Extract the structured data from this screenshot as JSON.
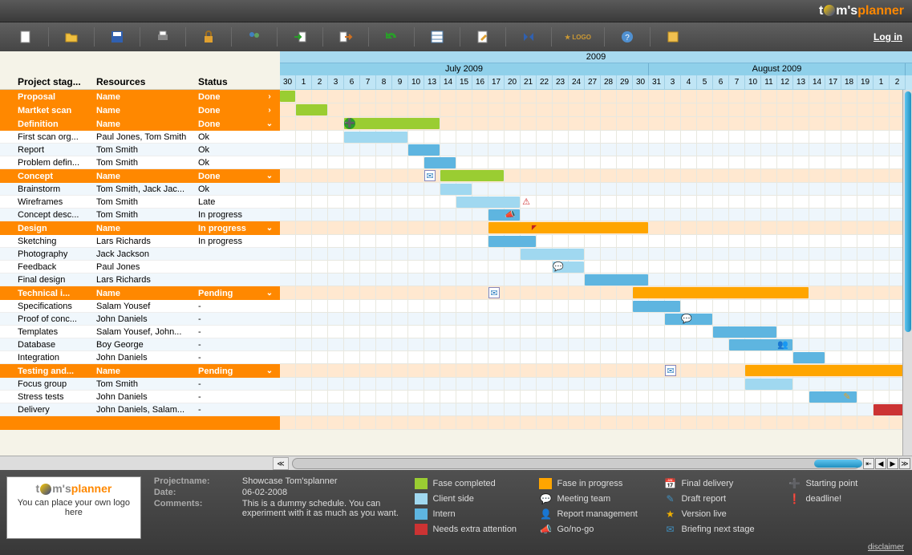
{
  "brand": {
    "t1": "t",
    "t2": "m's",
    "t3": "planner"
  },
  "login": "Log in",
  "columns": {
    "c1": "Project stag...",
    "c2": "Resources",
    "c3": "Status"
  },
  "timeline": {
    "year": "2009",
    "months": [
      {
        "label": "July 2009",
        "span": 23
      },
      {
        "label": "August 2009",
        "span": 16
      }
    ],
    "days": [
      "30",
      "1",
      "2",
      "3",
      "6",
      "7",
      "8",
      "9",
      "10",
      "13",
      "14",
      "15",
      "16",
      "17",
      "20",
      "21",
      "22",
      "23",
      "24",
      "27",
      "28",
      "29",
      "30",
      "31",
      "3",
      "4",
      "5",
      "6",
      "7",
      "10",
      "11",
      "12",
      "13",
      "14",
      "17",
      "18",
      "19",
      "1",
      "2"
    ]
  },
  "cellw": 20,
  "rows": [
    {
      "type": "phase",
      "c1": "Proposal",
      "c2": "Name",
      "c3": "Done",
      "caret": "›",
      "bars": [
        {
          "s": 0,
          "e": 1,
          "c": "green"
        }
      ]
    },
    {
      "type": "phase",
      "c1": "Martket scan",
      "c2": "Name",
      "c3": "Done",
      "caret": "›",
      "bars": [
        {
          "s": 1,
          "e": 3,
          "c": "green"
        }
      ]
    },
    {
      "type": "phase",
      "c1": "Definition",
      "c2": "Name",
      "c3": "Done",
      "caret": "⌄",
      "bars": [
        {
          "s": 4,
          "e": 10,
          "c": "green"
        }
      ],
      "icons": [
        {
          "p": 4,
          "t": "➕",
          "bg": "#2a9d2a",
          "col": "#fff",
          "r": "50%"
        }
      ]
    },
    {
      "type": "task",
      "c1": "First scan org...",
      "c2": "Paul Jones, Tom Smith",
      "c3": "Ok",
      "bars": [
        {
          "s": 4,
          "e": 8,
          "c": "lblue"
        }
      ]
    },
    {
      "type": "task",
      "alt": 1,
      "c1": "Report",
      "c2": "Tom Smith",
      "c3": "Ok",
      "bars": [
        {
          "s": 8,
          "e": 10,
          "c": "blue"
        }
      ]
    },
    {
      "type": "task",
      "c1": "Problem defin...",
      "c2": "Tom Smith",
      "c3": "Ok",
      "bars": [
        {
          "s": 9,
          "e": 11,
          "c": "blue"
        }
      ]
    },
    {
      "type": "phase",
      "c1": "Concept",
      "c2": "Name",
      "c3": "Done",
      "caret": "⌄",
      "bars": [
        {
          "s": 10,
          "e": 14,
          "c": "green"
        }
      ],
      "icons": [
        {
          "p": 9,
          "t": "✉",
          "bg": "#fff",
          "col": "#3080c0",
          "b": "1px solid #88b"
        }
      ]
    },
    {
      "type": "task",
      "alt": 1,
      "c1": "Brainstorm",
      "c2": "Tom Smith, Jack Jac...",
      "c3": "Ok",
      "bars": [
        {
          "s": 10,
          "e": 12,
          "c": "lblue"
        }
      ]
    },
    {
      "type": "task",
      "c1": "Wireframes",
      "c2": "Tom Smith",
      "c3": "Late",
      "bars": [
        {
          "s": 11,
          "e": 15,
          "c": "lblue"
        }
      ],
      "icons": [
        {
          "p": 15,
          "t": "⚠",
          "col": "#d03030"
        }
      ]
    },
    {
      "type": "task",
      "alt": 1,
      "c1": "Concept desc...",
      "c2": "Tom Smith",
      "c3": "In progress",
      "bars": [
        {
          "s": 13,
          "e": 15,
          "c": "blue"
        }
      ],
      "icons": [
        {
          "p": 14,
          "t": "📣",
          "col": "#e8a020"
        }
      ]
    },
    {
      "type": "phase",
      "c1": "Design",
      "c2": "Name",
      "c3": "In progress",
      "caret": "⌄",
      "bars": [
        {
          "s": 13,
          "e": 23,
          "c": "orange"
        }
      ],
      "icons": [
        {
          "p": 15.5,
          "t": "◤",
          "col": "#c02020",
          "fs": "8px"
        }
      ]
    },
    {
      "type": "task",
      "c1": "Sketching",
      "c2": "Lars Richards",
      "c3": "In progress",
      "bars": [
        {
          "s": 13,
          "e": 16,
          "c": "blue"
        }
      ]
    },
    {
      "type": "task",
      "alt": 1,
      "c1": "Photography",
      "c2": "Jack Jackson",
      "c3": "",
      "bars": [
        {
          "s": 15,
          "e": 19,
          "c": "lblue"
        }
      ]
    },
    {
      "type": "task",
      "c1": "Feedback",
      "c2": "Paul Jones",
      "c3": "",
      "bars": [
        {
          "s": 17,
          "e": 19,
          "c": "lblue"
        }
      ],
      "icons": [
        {
          "p": 17,
          "t": "💬",
          "col": "#4090c0"
        }
      ]
    },
    {
      "type": "task",
      "alt": 1,
      "c1": "Final design",
      "c2": "Lars Richards",
      "c3": "",
      "bars": [
        {
          "s": 19,
          "e": 23,
          "c": "blue"
        }
      ]
    },
    {
      "type": "phase",
      "c1": "Technical i...",
      "c2": "Name",
      "c3": "Pending",
      "caret": "⌄",
      "bars": [
        {
          "s": 22,
          "e": 33,
          "c": "orange"
        }
      ],
      "icons": [
        {
          "p": 13,
          "t": "✉",
          "bg": "#fff",
          "col": "#3080c0",
          "b": "1px solid #88b"
        }
      ]
    },
    {
      "type": "task",
      "c1": "Specifications",
      "c2": "Salam Yousef",
      "c3": "-",
      "bars": [
        {
          "s": 22,
          "e": 25,
          "c": "blue"
        }
      ]
    },
    {
      "type": "task",
      "alt": 1,
      "c1": "Proof of conc...",
      "c2": "John Daniels",
      "c3": "-",
      "bars": [
        {
          "s": 24,
          "e": 27,
          "c": "blue"
        }
      ],
      "icons": [
        {
          "p": 25,
          "t": "💬",
          "col": "#4090c0"
        }
      ]
    },
    {
      "type": "task",
      "c1": "Templates",
      "c2": "Salam Yousef, John...",
      "c3": "-",
      "bars": [
        {
          "s": 27,
          "e": 31,
          "c": "blue"
        }
      ]
    },
    {
      "type": "task",
      "alt": 1,
      "c1": "Database",
      "c2": "Boy George",
      "c3": "-",
      "bars": [
        {
          "s": 28,
          "e": 32,
          "c": "blue"
        }
      ],
      "icons": [
        {
          "p": 31,
          "t": "👥",
          "col": "#e08030"
        }
      ]
    },
    {
      "type": "task",
      "c1": "Integration",
      "c2": "John Daniels",
      "c3": "-",
      "bars": [
        {
          "s": 32,
          "e": 34,
          "c": "blue"
        }
      ]
    },
    {
      "type": "phase",
      "c1": "Testing and...",
      "c2": "Name",
      "c3": "Pending",
      "caret": "⌄",
      "bars": [
        {
          "s": 29,
          "e": 39,
          "c": "orange"
        }
      ],
      "icons": [
        {
          "p": 24,
          "t": "✉",
          "bg": "#fff",
          "col": "#3080c0",
          "b": "1px solid #88b"
        }
      ]
    },
    {
      "type": "task",
      "alt": 1,
      "c1": "Focus group",
      "c2": "Tom Smith",
      "c3": "-",
      "bars": [
        {
          "s": 29,
          "e": 32,
          "c": "lblue"
        }
      ]
    },
    {
      "type": "task",
      "c1": "Stress tests",
      "c2": "John Daniels",
      "c3": "-",
      "bars": [
        {
          "s": 33,
          "e": 36,
          "c": "blue"
        }
      ],
      "icons": [
        {
          "p": 35,
          "t": "✎",
          "col": "#e8a020"
        }
      ]
    },
    {
      "type": "task",
      "alt": 1,
      "c1": "Delivery",
      "c2": "John Daniels, Salam...",
      "c3": "-",
      "bars": [
        {
          "s": 37,
          "e": 39,
          "c": "red"
        }
      ]
    },
    {
      "type": "phase",
      "c1": "",
      "c2": "",
      "c3": "",
      "caret": "",
      "bars": []
    }
  ],
  "footer": {
    "logobox": {
      "main": "tom'splanner",
      "sub": "You can place your own logo here"
    },
    "info": [
      {
        "label": "Projectname:",
        "val": "Showcase Tom'splanner"
      },
      {
        "label": "Date:",
        "val": "06-02-2008"
      },
      {
        "label": "Comments:",
        "val": "This is a dummy schedule. You can experiment with it as much as you want."
      }
    ],
    "legend": [
      {
        "kind": "sw",
        "color": "#9acd32",
        "label": "Fase completed"
      },
      {
        "kind": "sw",
        "color": "#a0d8f0",
        "label": "Client side"
      },
      {
        "kind": "sw",
        "color": "#5eb5e0",
        "label": "Intern"
      },
      {
        "kind": "sw",
        "color": "#cc3333",
        "label": "Needs extra attention"
      },
      {
        "kind": "sw",
        "color": "#ffa500",
        "label": "Fase in progress"
      },
      {
        "kind": "ic",
        "glyph": "💬",
        "label": "Meeting team"
      },
      {
        "kind": "ic",
        "glyph": "👤",
        "label": "Report management"
      },
      {
        "kind": "ic",
        "glyph": "📣",
        "label": "Go/no-go"
      },
      {
        "kind": "ic",
        "glyph": "📅",
        "label": "Final delivery"
      },
      {
        "kind": "ic",
        "glyph": "✎",
        "label": "Draft report"
      },
      {
        "kind": "ic",
        "glyph": "★",
        "label": "Version live",
        "col": "#f0b000"
      },
      {
        "kind": "ic",
        "glyph": "✉",
        "label": "Briefing next stage"
      },
      {
        "kind": "ic",
        "glyph": "➕",
        "label": "Starting point",
        "col": "#2a9d2a"
      },
      {
        "kind": "ic",
        "glyph": "❗",
        "label": "deadline!",
        "col": "#d04040"
      }
    ],
    "disclaimer": "disclaimer"
  },
  "toolbar_logo": "★ LOGO"
}
